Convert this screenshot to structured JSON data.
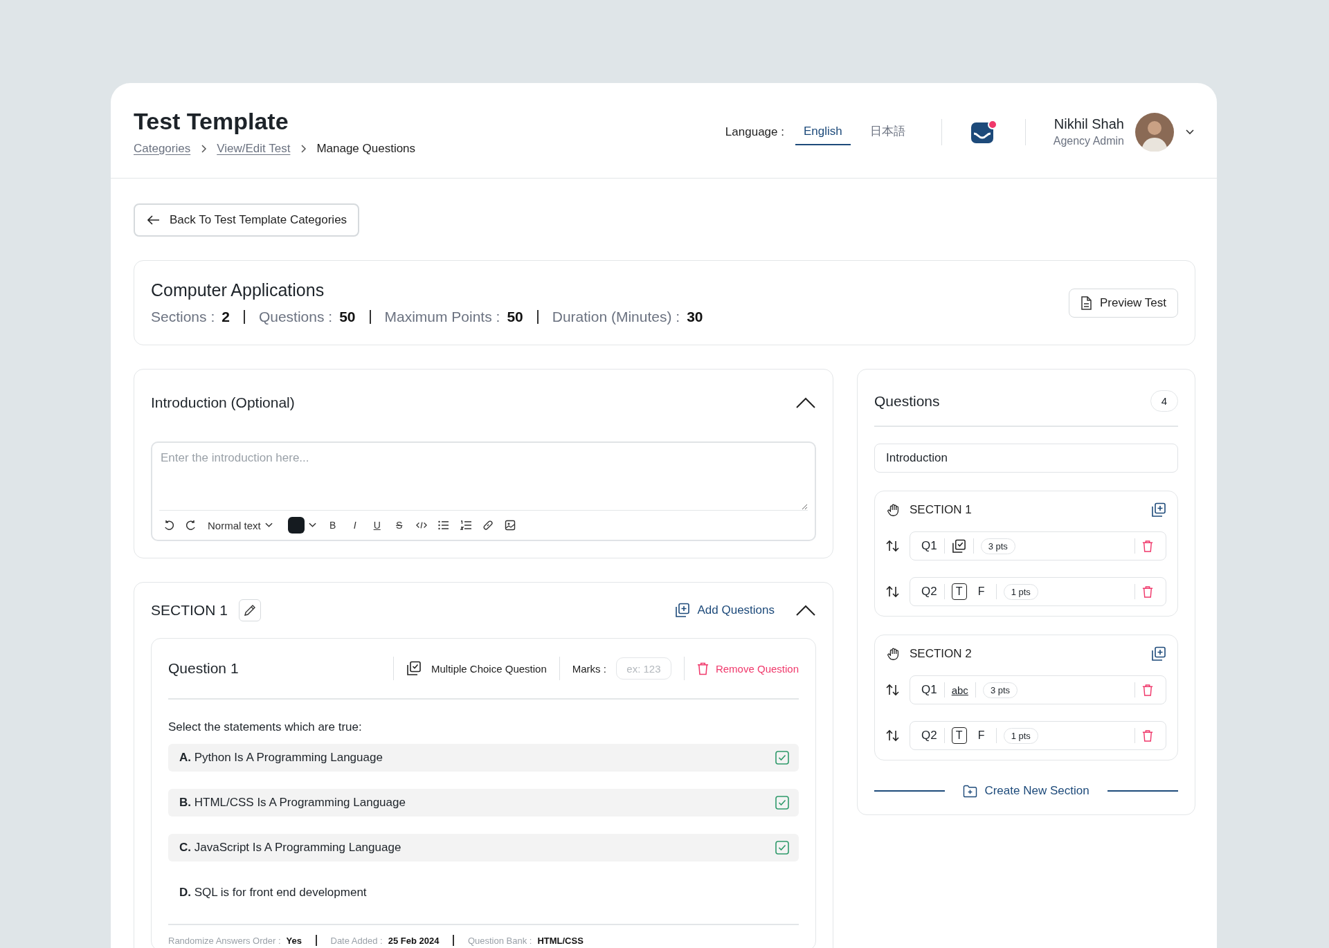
{
  "header": {
    "title": "Test Template",
    "breadcrumbs": [
      {
        "label": "Categories",
        "link": true
      },
      {
        "label": "View/Edit Test",
        "link": true
      },
      {
        "label": "Manage Questions",
        "link": false
      }
    ],
    "language_label": "Language :",
    "languages": [
      {
        "label": "English",
        "selected": true
      },
      {
        "label": "日本語",
        "selected": false
      }
    ],
    "has_notification": true,
    "user": {
      "name": "Nikhil Shah",
      "role": "Agency Admin"
    }
  },
  "back_button": "Back To Test Template Categories",
  "test": {
    "title": "Computer Applications",
    "stats": [
      {
        "label": "Sections :",
        "value": "2"
      },
      {
        "label": "Questions :",
        "value": "50"
      },
      {
        "label": "Maximum Points :",
        "value": "50"
      },
      {
        "label": "Duration (Minutes) :",
        "value": "30"
      }
    ],
    "preview_button": "Preview Test"
  },
  "introduction": {
    "title": "Introduction (Optional)",
    "expanded": true,
    "placeholder": "Enter the introduction here...",
    "text_style": "Normal text",
    "format_buttons": [
      {
        "kind": "bold",
        "glyph": "B"
      },
      {
        "kind": "italic",
        "glyph": "I"
      },
      {
        "kind": "underline",
        "glyph": "U"
      },
      {
        "kind": "strike",
        "glyph": "S"
      }
    ]
  },
  "section": {
    "title": "SECTION 1",
    "add_questions": "Add Questions",
    "expanded": true,
    "question": {
      "title": "Question 1",
      "type_label": "Multiple Choice Question",
      "marks_label": "Marks :",
      "marks_placeholder": "ex: 123",
      "remove": "Remove Question",
      "prompt": "Select the statements which are true:",
      "options": [
        {
          "letter": "A.",
          "text": "Python Is A Programming Language",
          "checked": true
        },
        {
          "letter": "B.",
          "text": "HTML/CSS Is A Programming Language",
          "checked": true
        },
        {
          "letter": "C.",
          "text": "JavaScript Is A Programming Language",
          "checked": true
        },
        {
          "letter": "D.",
          "text": "SQL is for front end development",
          "checked": false
        }
      ],
      "meta": [
        {
          "label": "Randomize Answers Order :",
          "value": "Yes"
        },
        {
          "label": "Date Added :",
          "value": "25 Feb 2024"
        },
        {
          "label": "Question Bank :",
          "value": "HTML/CSS"
        }
      ]
    }
  },
  "questions_panel": {
    "title": "Questions",
    "count": "4",
    "introduction": "Introduction",
    "sections": [
      {
        "title": "SECTION 1",
        "questions": [
          {
            "label": "Q1",
            "kind": "multiple",
            "points": "3 pts"
          },
          {
            "label": "Q2",
            "kind": "truefalse",
            "choices": [
              {
                "label": "T",
                "selected": true
              },
              {
                "label": "F",
                "selected": false
              }
            ],
            "points": "1 pts"
          }
        ]
      },
      {
        "title": "SECTION 2",
        "questions": [
          {
            "label": "Q1",
            "kind": "text",
            "type_text": "abc",
            "points": "3 pts"
          },
          {
            "label": "Q2",
            "kind": "truefalse",
            "choices": [
              {
                "label": "T",
                "selected": true
              },
              {
                "label": "F",
                "selected": false
              }
            ],
            "points": "1 pts"
          }
        ]
      }
    ],
    "create_section": "Create New Section"
  }
}
